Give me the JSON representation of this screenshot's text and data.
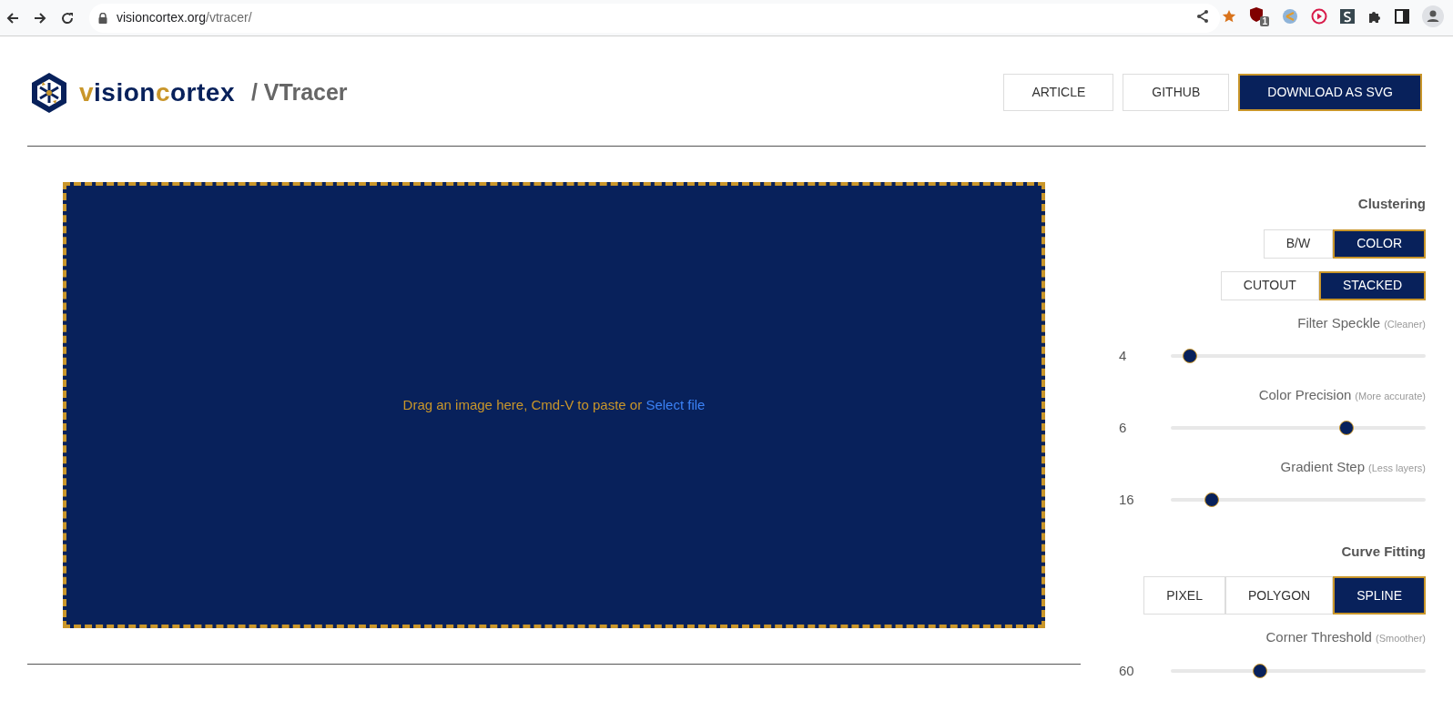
{
  "browser": {
    "url_host": "visioncortex.org",
    "url_path": "/vtracer/",
    "extension_badge": "1"
  },
  "header": {
    "logo_parts": [
      {
        "text": "v",
        "accent": true
      },
      {
        "text": "ision",
        "accent": false
      },
      {
        "text": "c",
        "accent": true
      },
      {
        "text": "ortex",
        "accent": false
      }
    ],
    "subtitle": "/ VTracer",
    "buttons": [
      {
        "label": "ARTICLE",
        "primary": false
      },
      {
        "label": "GITHUB",
        "primary": false
      },
      {
        "label": "DOWNLOAD AS SVG",
        "primary": true
      }
    ]
  },
  "dropzone": {
    "text": "Drag an image here, Cmd-V to paste or ",
    "link": "Select file"
  },
  "settings": [
    {
      "kind": "heading",
      "text": "Clustering"
    },
    {
      "kind": "toggle",
      "options": [
        {
          "label": "B/W",
          "selected": false
        },
        {
          "label": "COLOR",
          "selected": true
        }
      ]
    },
    {
      "kind": "toggle",
      "options": [
        {
          "label": "CUTOUT",
          "selected": false
        },
        {
          "label": "STACKED",
          "selected": true
        }
      ]
    },
    {
      "kind": "slider",
      "label": "Filter Speckle",
      "hint": "(Cleaner)",
      "reading": "4",
      "level": 0.05
    },
    {
      "kind": "slider",
      "label": "Color Precision",
      "hint": "(More accurate)",
      "reading": "6",
      "level": 0.7
    },
    {
      "kind": "slider",
      "label": "Gradient Step",
      "hint": "(Less layers)",
      "reading": "16",
      "level": 0.14
    },
    {
      "kind": "heading",
      "text": "Curve Fitting"
    },
    {
      "kind": "toggle",
      "options": [
        {
          "label": "PIXEL",
          "selected": false
        },
        {
          "label": "POLYGON",
          "selected": false
        },
        {
          "label": "SPLINE",
          "selected": true
        }
      ]
    },
    {
      "kind": "slider",
      "label": "Corner Threshold",
      "hint": "(Smoother)",
      "reading": "60",
      "level": 0.34
    }
  ]
}
